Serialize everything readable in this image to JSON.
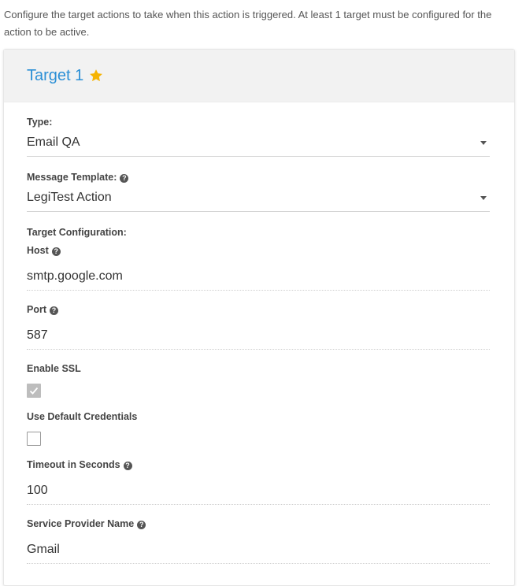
{
  "intro": "Configure the target actions to take when this action is triggered. At least 1 target must be configured for the action to be active.",
  "target": {
    "title": "Target 1",
    "icon": "star-icon",
    "accent": "#2b8fd6",
    "star_color": "#f5b301"
  },
  "fields": {
    "type": {
      "label": "Type:",
      "value": "Email QA"
    },
    "template": {
      "label": "Message Template:",
      "value": "LegiTest Action"
    },
    "config_label": "Target Configuration:",
    "host": {
      "label": "Host",
      "value": "smtp.google.com"
    },
    "port": {
      "label": "Port",
      "value": "587"
    },
    "ssl": {
      "label": "Enable SSL",
      "checked": true
    },
    "default_creds": {
      "label": "Use Default Credentials",
      "checked": false
    },
    "timeout": {
      "label": "Timeout in Seconds",
      "value": "100"
    },
    "provider": {
      "label": "Service Provider Name",
      "value": "Gmail"
    }
  }
}
